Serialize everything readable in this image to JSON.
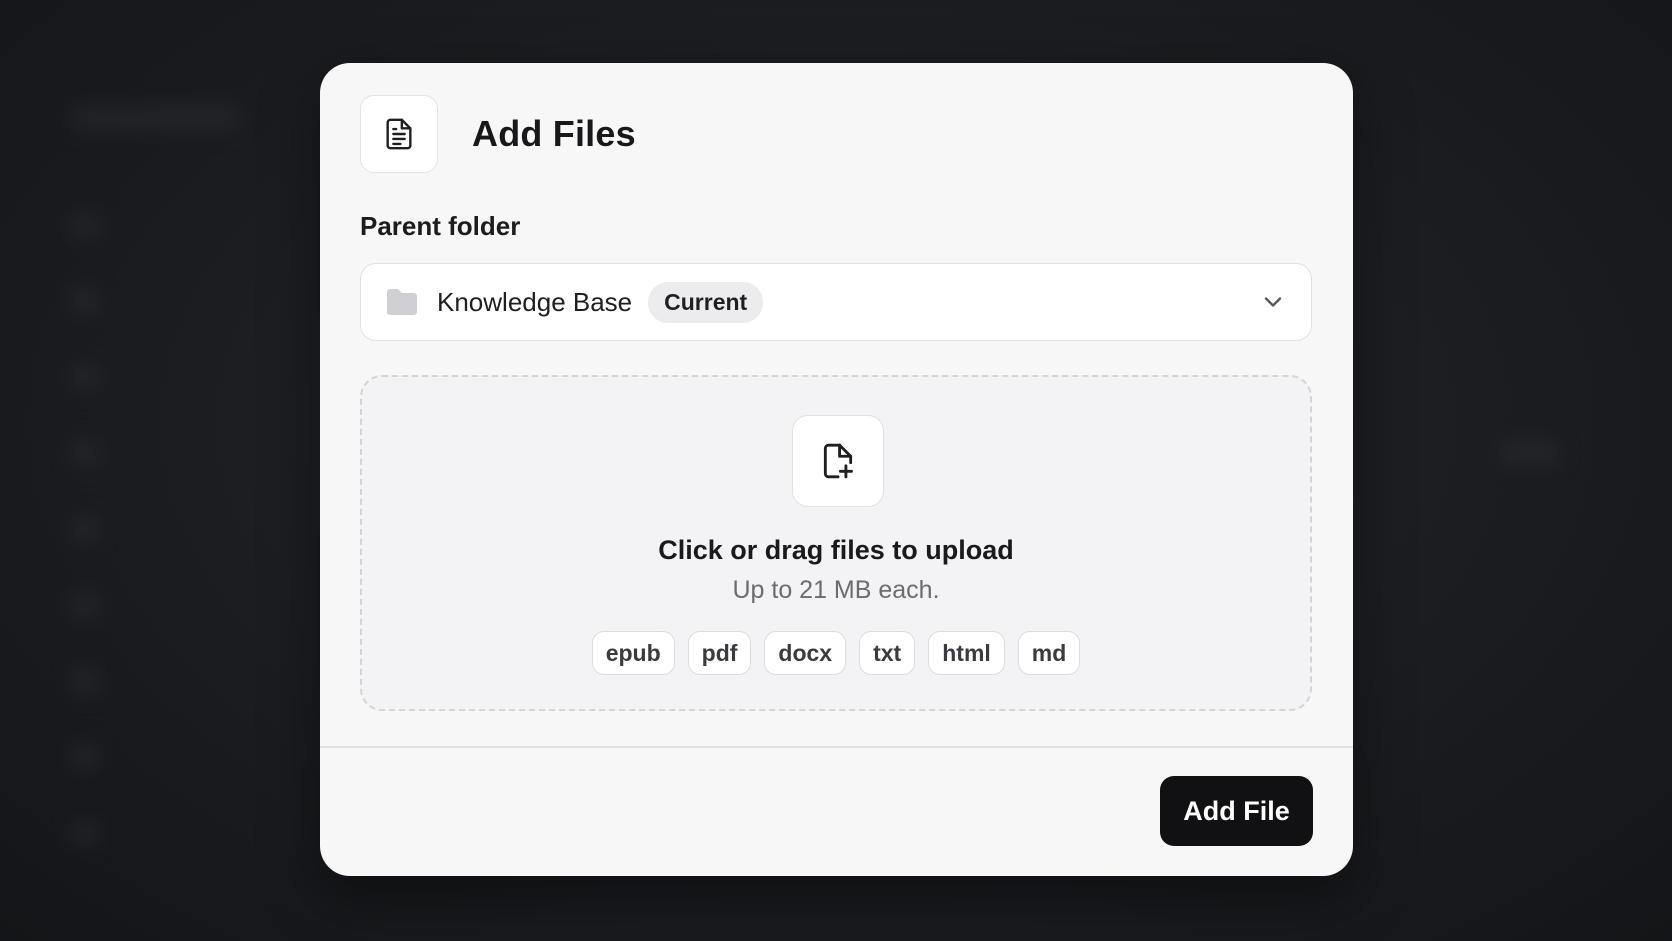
{
  "dialog": {
    "title": "Add Files",
    "header_icon": "document-icon"
  },
  "parent_folder": {
    "label": "Parent folder",
    "selected_value": "Knowledge Base",
    "badge": "Current",
    "folder_icon": "folder-icon",
    "dropdown_icon": "chevron-down-icon"
  },
  "dropzone": {
    "icon": "file-plus-icon",
    "title": "Click or drag files to upload",
    "subtitle": "Up to 21 MB each.",
    "file_types": [
      "epub",
      "pdf",
      "docx",
      "txt",
      "html",
      "md"
    ]
  },
  "footer": {
    "submit_label": "Add File"
  },
  "colors": {
    "primary_button": "#111113",
    "modal_background": "#f7f7f8",
    "backdrop": "#1b1d21"
  }
}
